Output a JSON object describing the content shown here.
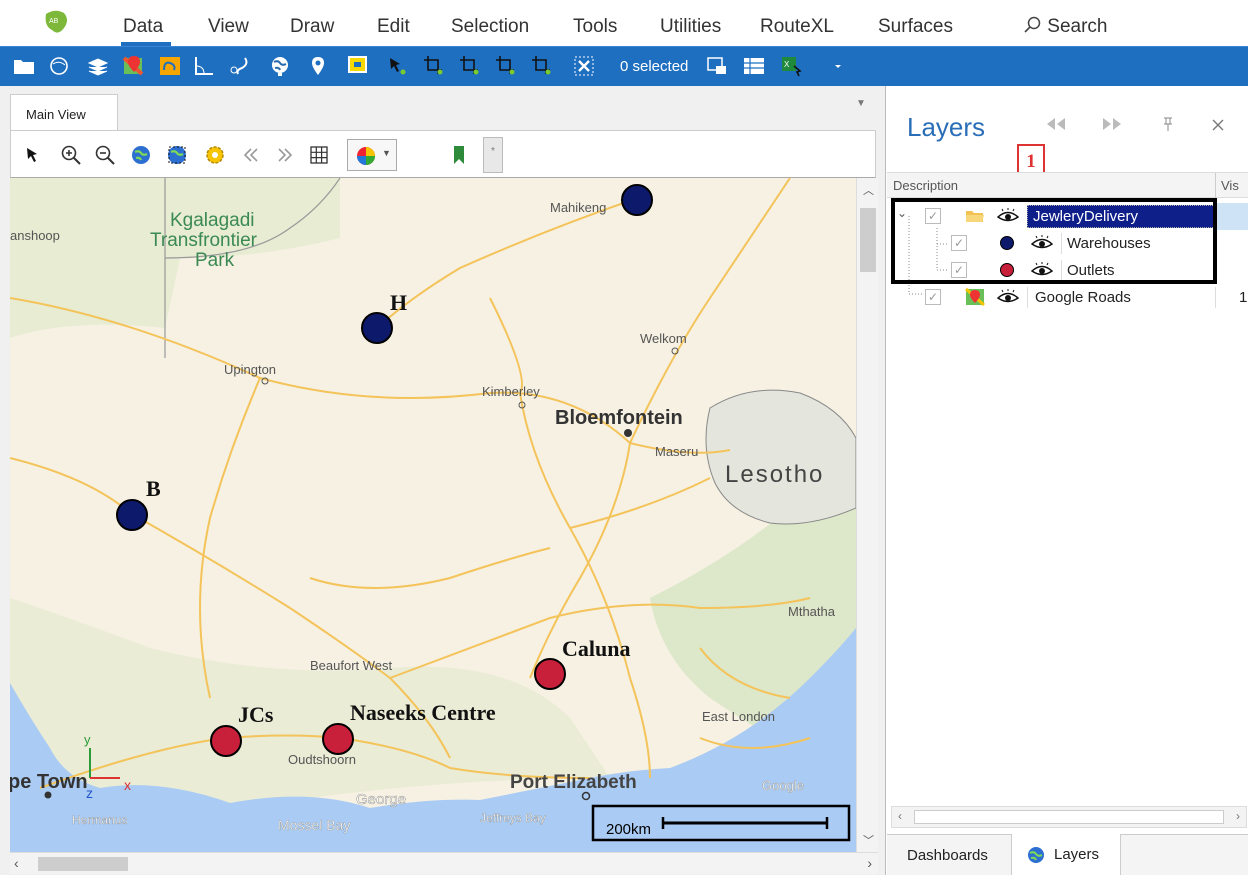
{
  "menu": {
    "items": [
      "Data",
      "View",
      "Draw",
      "Edit",
      "Selection",
      "Tools",
      "Utilities",
      "RouteXL",
      "Surfaces"
    ],
    "search_label": "Search"
  },
  "toolbar": {
    "selected_label": "0 selected"
  },
  "main_view": {
    "tab_label": "Main View",
    "hidden_panel_label": "*"
  },
  "map": {
    "labels": {
      "kgalagadi1": "Kgalagadi",
      "kgalagadi2": "Transfrontier",
      "kgalagadi3": "Park",
      "keetmanshoop": "anshoop",
      "mahikeng": "Mahikeng",
      "welkom": "Welkom",
      "upington": "Upington",
      "kimberley": "Kimberley",
      "bloemfontein": "Bloemfontein",
      "maseru": "Maseru",
      "lesotho": "Lesotho",
      "mthatha": "Mthatha",
      "beaufort_west": "Beaufort West",
      "east_london": "East London",
      "oudtshoorn": "Oudtshoorn",
      "port_elizabeth": "Port Elizabeth",
      "cape_town": "pe Town",
      "george": "George",
      "hermanus": "Hermanus",
      "mossel_bay": "Mossel Bay",
      "jeffreys_bay": "Jeffreys Bay",
      "google": "Google"
    },
    "points": {
      "h": "H",
      "b": "B",
      "jcs": "JCs",
      "naseeks": "Naseeks Centre",
      "caluna": "Caluna"
    },
    "axis": {
      "x": "x",
      "y": "y",
      "z": "z"
    },
    "scale_label": "200km",
    "colors": {
      "warehouse": "#0d1a6b",
      "outlet": "#c8203a",
      "water": "#a9c9f2",
      "land": "#f5f0e1"
    }
  },
  "layers": {
    "title": "Layers",
    "annotation": "1",
    "columns": {
      "description": "Description",
      "visible": "Vis"
    },
    "rows": {
      "group": "JewleryDelivery",
      "warehouses": "Warehouses",
      "outlets": "Outlets",
      "roads": "Google Roads"
    },
    "roads_vis": "1",
    "bottom_tabs": {
      "dashboards": "Dashboards",
      "layers": "Layers"
    }
  }
}
